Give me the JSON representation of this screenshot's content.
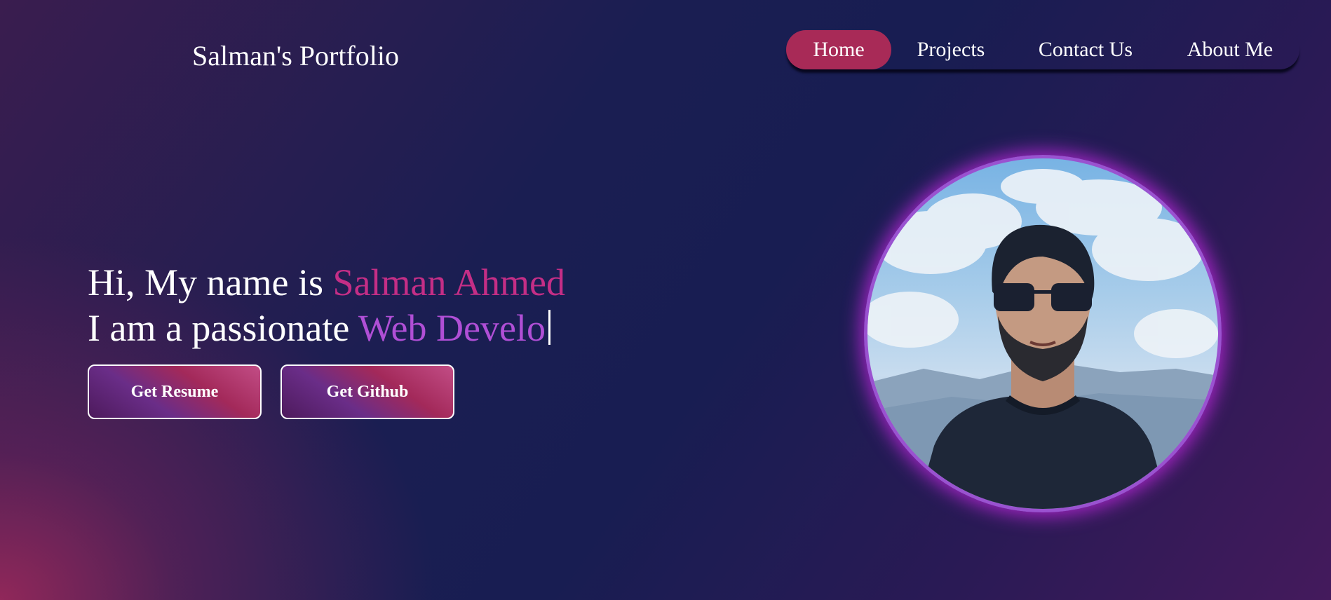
{
  "header": {
    "brand": "Salman's Portfolio",
    "nav": [
      {
        "label": "Home",
        "active": true
      },
      {
        "label": "Projects",
        "active": false
      },
      {
        "label": "Contact Us",
        "active": false
      },
      {
        "label": "About Me",
        "active": false
      }
    ]
  },
  "hero": {
    "line1_prefix": "Hi, My name is ",
    "line1_name": "Salman Ahmed",
    "line2_prefix": "I am a passionate ",
    "line2_role_typed": "Web Develo",
    "buttons": {
      "resume": "Get Resume",
      "github": "Get Github"
    }
  },
  "colors": {
    "accent_pink": "#c42e86",
    "accent_purple": "#b04fd6",
    "nav_active": "#a82a57",
    "avatar_ring": "#9a52d0"
  },
  "icons": {
    "profile_photo": "profile-photo"
  }
}
